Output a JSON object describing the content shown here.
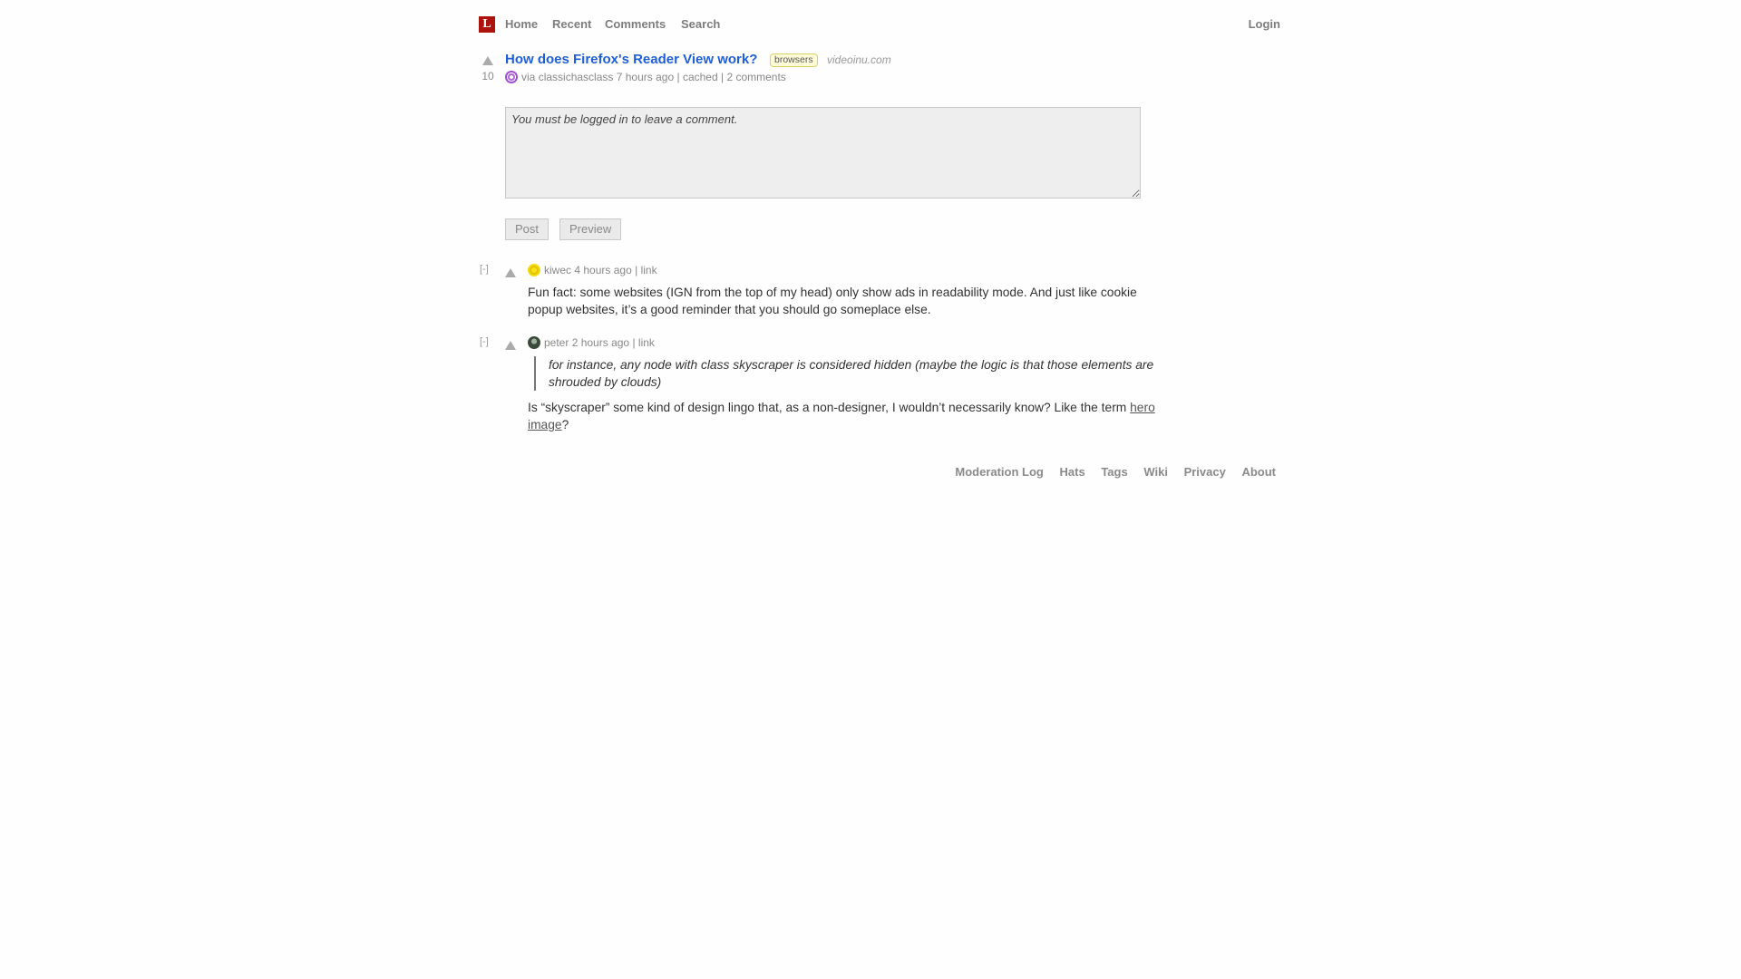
{
  "header": {
    "logo_letter": "L",
    "nav": {
      "home": "Home",
      "recent": "Recent",
      "comments": "Comments",
      "search": "Search",
      "login": "Login"
    }
  },
  "story": {
    "score": "10",
    "title": "How does Firefox's Reader View work?",
    "tag": "browsers",
    "domain": "videoinu.com",
    "via": "via",
    "author": "classichasclass",
    "time": "7 hours ago",
    "sep1": "|",
    "cached": "cached",
    "sep2": "|",
    "comments_link": "2 comments"
  },
  "comment_form": {
    "placeholder": "You must be logged in to leave a comment.",
    "post_label": "Post",
    "preview_label": "Preview"
  },
  "comments": [
    {
      "toggle": "[-]",
      "author": "kiwec",
      "time": "4 hours ago",
      "sep": "|",
      "link_label": "link",
      "text": "Fun fact: some websites (IGN from the top of my head) only show ads in readability mode. And just like cookie popup websites, it’s a good reminder that you should go someplace else."
    },
    {
      "toggle": "[-]",
      "author": "peter",
      "time": "2 hours ago",
      "sep": "|",
      "link_label": "link",
      "quote": "for instance, any node with class skyscraper is considered hidden (maybe the logic is that those elements are shrouded by clouds)",
      "text_before": "Is “skyscraper” some kind of design lingo that, as a non-designer, I wouldn’t necessarily know? Like the term ",
      "text_link": "hero image",
      "text_after": "?"
    }
  ],
  "footer": {
    "moderation_log": "Moderation Log",
    "hats": "Hats",
    "tags": "Tags",
    "wiki": "Wiki",
    "privacy": "Privacy",
    "about": "About"
  }
}
